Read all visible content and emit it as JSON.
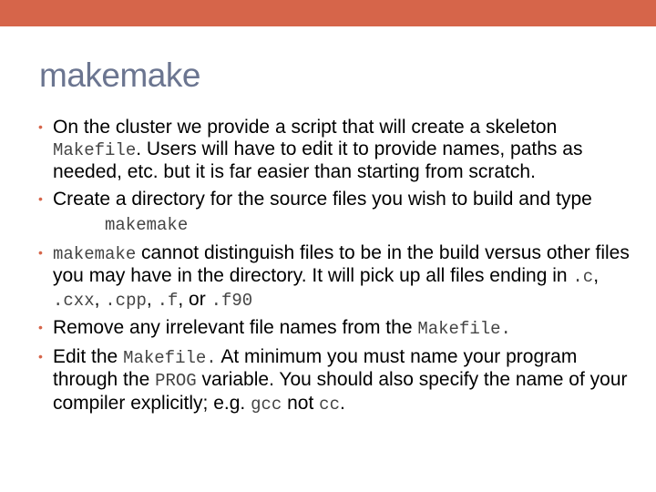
{
  "colors": {
    "accent": "#d6654a",
    "title": "#6b7590"
  },
  "slide": {
    "title": "makemake",
    "bullet_glyph": "•",
    "b1": {
      "t1": "On the cluster we provide a script that will create a skeleton ",
      "c1": "Makefile",
      "t2": ".  Users will have to edit it to provide names, paths as needed, etc. but it is far easier than starting from scratch."
    },
    "b2": {
      "t1": "Create a directory for the source files you wish to build and type"
    },
    "command": "makemake",
    "b3": {
      "c1": "makemake",
      "t1": " cannot distinguish files to be in the build versus other files you may have in the directory.  It will pick up all files ending in ",
      "c2": ".c",
      "t2": ", ",
      "c3": ".cxx",
      "t3": ", ",
      "c4": ".cpp",
      "t4": ", ",
      "c5": ".f",
      "t5": ", or ",
      "c6": ".f90"
    },
    "b4": {
      "t1": "Remove any irrelevant file names from the ",
      "c1": "Makefile."
    },
    "b5": {
      "t1": "Edit the ",
      "c1": "Makefile.",
      "t2": "  At minimum you must name your program through the ",
      "c2": "PROG",
      "t3": " variable.  You should also specify the name of your compiler explicitly; e.g. ",
      "c3": "gcc",
      "t4": " not ",
      "c4": "cc",
      "t5": "."
    }
  }
}
